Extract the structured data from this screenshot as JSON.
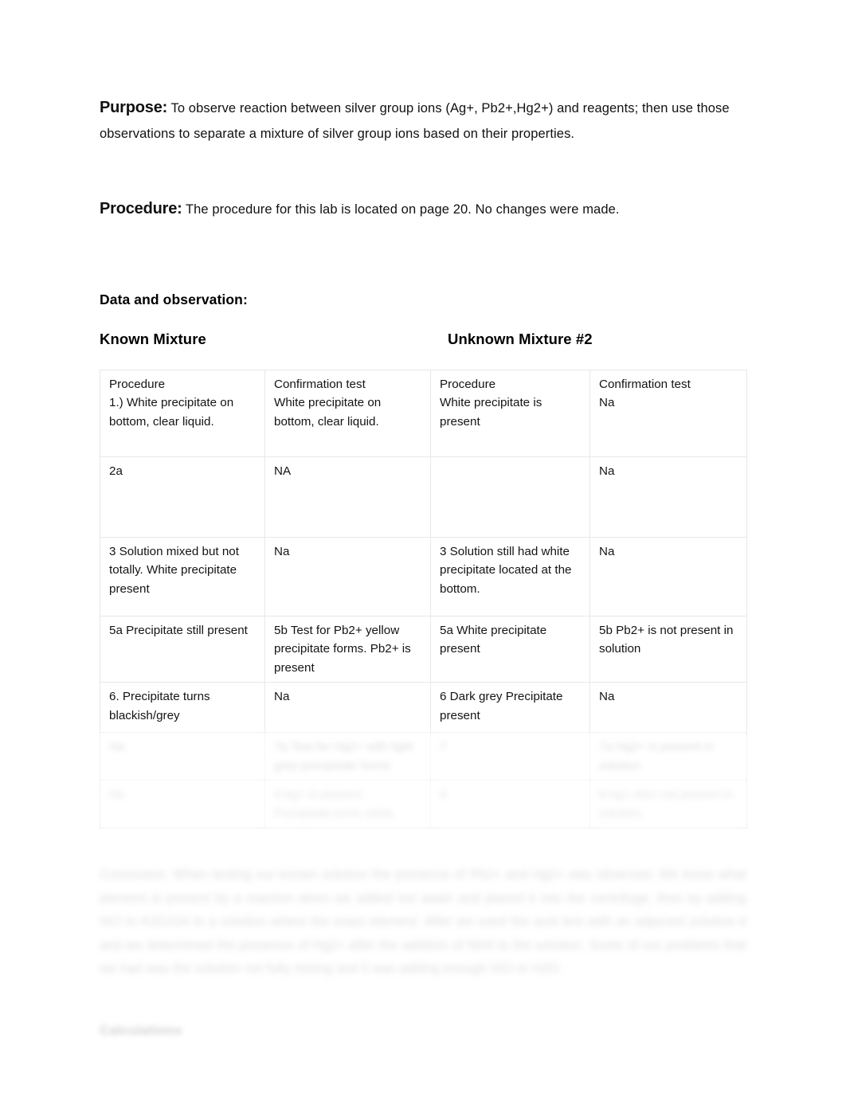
{
  "document": {
    "purpose": {
      "label": "Purpose:",
      "text": " To observe reaction between silver group ions (Ag+, Pb2+,Hg2+) and reagents; then use those observations to separate a mixture of silver group ions based on their properties."
    },
    "procedure": {
      "label": "Procedure:",
      "text": " The procedure for this lab is located on page 20.  No changes were made."
    },
    "data_section_title": "Data and observation:",
    "mixtures": {
      "known": "Known Mixture",
      "unknown": "Unknown Mixture #2"
    },
    "table": {
      "headers": {
        "known_procedure": "Procedure",
        "known_confirmation": "Confirmation test",
        "unknown_procedure": "Procedure",
        "unknown_confirmation": "Confirmation test"
      },
      "rows": [
        {
          "known_procedure": "1.) White precipitate on bottom, clear liquid.",
          "known_confirmation": "White precipitate on bottom, clear liquid.",
          "unknown_procedure": "White precipitate is present",
          "unknown_confirmation": "Na"
        },
        {
          "known_procedure": "2a",
          "known_confirmation": "NA",
          "unknown_procedure": "",
          "unknown_confirmation": "Na"
        },
        {
          "known_procedure": "3 Solution mixed but not totally. White precipitate present",
          "known_confirmation": "Na",
          "unknown_procedure": "3 Solution still had white precipitate located at the bottom.",
          "unknown_confirmation": "Na"
        },
        {
          "known_procedure": "5a Precipitate still present",
          "known_confirmation": "5b Test for Pb2+ yellow precipitate forms. Pb2+ is present",
          "unknown_procedure": "5a White precipitate present",
          "unknown_confirmation": "5b Pb2+ is not present in solution"
        },
        {
          "known_procedure": "6. Precipitate turns blackish/grey",
          "known_confirmation": "Na",
          "unknown_procedure": "6 Dark grey Precipitate present",
          "unknown_confirmation": "Na"
        },
        {
          "known_procedure": "Na",
          "known_confirmation": "7a Test for Hg2+ with light grey precipitate forms",
          "unknown_procedure": "7",
          "unknown_confirmation": "7a Hg2+ is present in solution"
        },
        {
          "known_procedure": "Na",
          "known_confirmation": "8 Ag+ is present. Precipitate turns white.",
          "unknown_procedure": "8",
          "unknown_confirmation": "8 Ag+ Also not present in solution."
        }
      ]
    },
    "conclusion": {
      "text": "Conclusion: When testing our known solution the presence of Pb2+ and Hg2+ was observed. We know what element is present by a reaction when we added hot water and placed it into the centrifuge, then by adding HCl to K2CrO4 to a solution where the exact element. After we used the acid test with an adjacent solution it and we determined the presence of Hg2+ after the addition of NH3 to the solution.  Some of our problems that we had was the solution not fully mixing and it was adding enough HCl or H2O."
    },
    "calculations_title": "Calculations"
  }
}
